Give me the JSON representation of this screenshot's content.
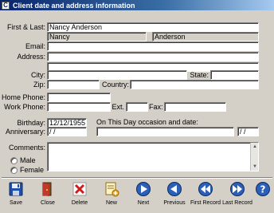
{
  "window": {
    "title": "Client date and address information"
  },
  "labels": {
    "first_last": "First & Last:",
    "email": "Email:",
    "address": "Address:",
    "city": "City:",
    "state": "State:",
    "zip": "Zip:",
    "country": "Country:",
    "home_phone": "Home Phone:",
    "work_phone": "Work Phone:",
    "ext": "Ext.",
    "fax": "Fax:",
    "birthday": "Birthday:",
    "anniversary": "Anniversary:",
    "occasion": "On This Day occasion and date:",
    "comments": "Comments:"
  },
  "fields": {
    "full_name": "Nancy Anderson",
    "first_name": "Nancy",
    "last_name": "Anderson",
    "email": "",
    "address1": "",
    "address2": "",
    "city": "",
    "state": "",
    "zip": "",
    "country": "",
    "home_phone": "",
    "work_phone": "",
    "ext": "",
    "fax": "",
    "birthday": "12/12/1955",
    "anniversary": " / /",
    "occasion": "",
    "occasion_date": " / /",
    "comments": ""
  },
  "gender": {
    "male": "Male",
    "female": "Female"
  },
  "toolbar": {
    "save": "Save",
    "close": "Close",
    "delete": "Delete",
    "new": "New",
    "next": "Next",
    "previous": "Previous",
    "first_record": "First Record",
    "last_record": "Last Record"
  },
  "colors": {
    "titlebar": "#0a246a",
    "window_bg": "#d4d0c8",
    "nav_blue": "#2b5fb8"
  }
}
